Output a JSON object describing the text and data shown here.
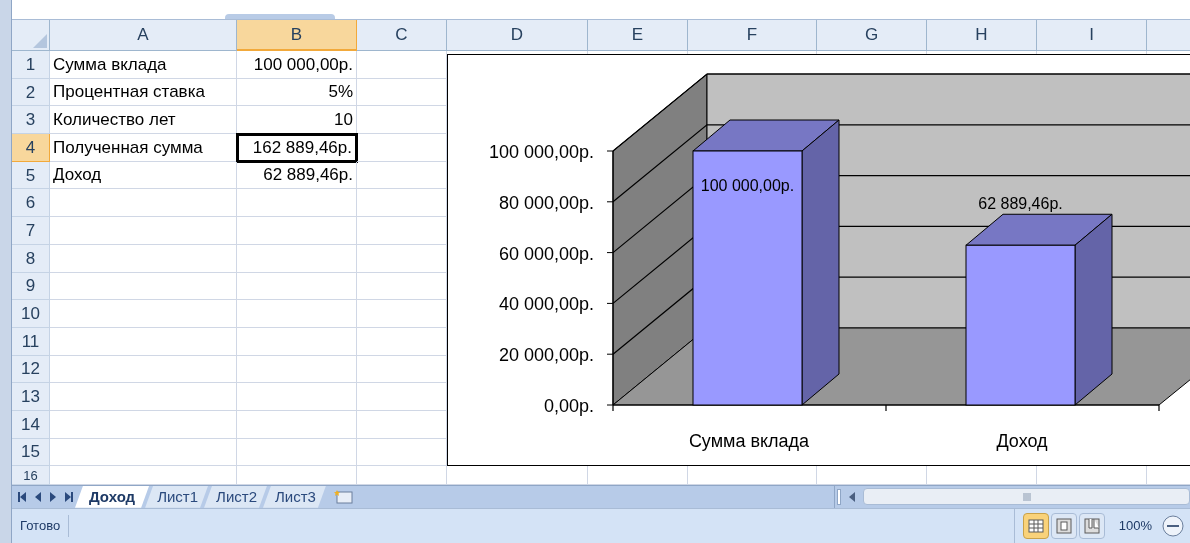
{
  "columns": [
    {
      "label": "A",
      "selected": false
    },
    {
      "label": "B",
      "selected": true
    },
    {
      "label": "C",
      "selected": false
    },
    {
      "label": "D",
      "selected": false
    },
    {
      "label": "E",
      "selected": false
    },
    {
      "label": "F",
      "selected": false
    },
    {
      "label": "G",
      "selected": false
    },
    {
      "label": "H",
      "selected": false
    },
    {
      "label": "I",
      "selected": false
    }
  ],
  "rows": [
    {
      "number": "1",
      "selected": false,
      "cells": [
        {
          "text": "Сумма вклада",
          "active": false
        },
        {
          "text": "100 000,00р.",
          "active": false
        }
      ]
    },
    {
      "number": "2",
      "selected": false,
      "cells": [
        {
          "text": "Процентная ставка",
          "active": false
        },
        {
          "text": "5%",
          "active": false
        }
      ]
    },
    {
      "number": "3",
      "selected": false,
      "cells": [
        {
          "text": "Количество лет",
          "active": false
        },
        {
          "text": "10",
          "active": false
        }
      ]
    },
    {
      "number": "4",
      "selected": true,
      "cells": [
        {
          "text": "Полученная сумма",
          "active": false
        },
        {
          "text": "162 889,46р.",
          "active": true
        }
      ]
    },
    {
      "number": "5",
      "selected": false,
      "cells": [
        {
          "text": "Доход",
          "active": false
        },
        {
          "text": "62 889,46р.",
          "active": false
        }
      ]
    },
    {
      "number": "6",
      "selected": false
    },
    {
      "number": "7",
      "selected": false
    },
    {
      "number": "8",
      "selected": false
    },
    {
      "number": "9",
      "selected": false
    },
    {
      "number": "10",
      "selected": false
    },
    {
      "number": "11",
      "selected": false
    },
    {
      "number": "12",
      "selected": false
    },
    {
      "number": "13",
      "selected": false
    },
    {
      "number": "14",
      "selected": false
    },
    {
      "number": "15",
      "selected": false
    },
    {
      "number": "16",
      "selected": false
    }
  ],
  "chart": {
    "chart_data": {
      "type": "bar",
      "categories": [
        "Сумма вклада",
        "Доход"
      ],
      "values": [
        100000,
        62889.46
      ],
      "ylim": [
        0,
        100000
      ],
      "yticks": [
        {
          "value": 0,
          "label": "0,00р."
        },
        {
          "value": 20000,
          "label": "20 000,00р."
        },
        {
          "value": 40000,
          "label": "40 000,00р."
        },
        {
          "value": 60000,
          "label": "60 000,00р."
        },
        {
          "value": 80000,
          "label": "80 000,00р."
        },
        {
          "value": 100000,
          "label": "100 000,00р."
        }
      ],
      "value_labels": [
        "100 000,00р.",
        "62 889,46р."
      ]
    }
  },
  "sheet_tabs": [
    {
      "label": "Доход",
      "selected": true
    },
    {
      "label": "Лист1",
      "selected": false
    },
    {
      "label": "Лист2",
      "selected": false
    },
    {
      "label": "Лист3",
      "selected": false
    }
  ],
  "status_bar": {
    "text": "Готово",
    "views": [
      {
        "kind": "normal",
        "selected": true
      },
      {
        "kind": "page-layout",
        "selected": false
      },
      {
        "kind": "page-break",
        "selected": false
      }
    ],
    "zoom": "100%"
  }
}
